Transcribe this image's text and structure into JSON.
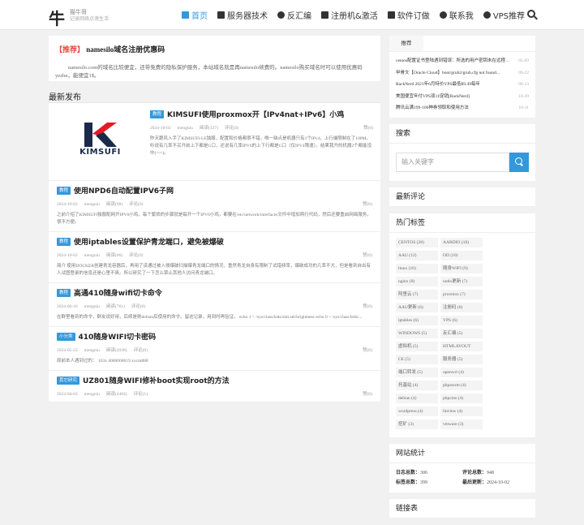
{
  "header": {
    "logo_char": "牛",
    "logo_title": "猫牛哥",
    "logo_sub": "记录网络点滴生活",
    "nav": [
      {
        "label": "首页",
        "icon": "home-icon",
        "active": true
      },
      {
        "label": "服务器技术",
        "icon": "server-icon"
      },
      {
        "label": "反汇编",
        "icon": "flask-icon"
      },
      {
        "label": "注册机&激活",
        "icon": "key-icon"
      },
      {
        "label": "软件订做",
        "icon": "folder-icon"
      },
      {
        "label": "联系我",
        "icon": "user-icon"
      },
      {
        "label": "VPS推荐",
        "icon": "heart-icon"
      }
    ]
  },
  "notice": {
    "tag": "【推荐】",
    "title": "namesilo域名注册优惠码",
    "text": "namesilo.com的域名比较便宜，还带免费的隐私保护服务，本站域名就是再namesilo续费的。namesilo购买域名时可以使用优惠码yezhu，能便宜1$。"
  },
  "latest_title": "最新发布",
  "posts": [
    {
      "cat": "教程",
      "title": "KIMSUFI使用proxmox开【IPv4nat+IPv6】小鸡",
      "date": "2024-10-02",
      "author": "mengniu",
      "reads": "阅读(127)",
      "comments": "评论(0)",
      "likes": "赞(0)",
      "excerpt": "昨天跟风入手了KIMSUFI-LE独服，配置和价格都很不错。唯一缺点是机器只有1个IPv4，上行端限制在了100M。听说有几率不买开前上下都是G口，还说有几率IPV6的上下行都是G口（仅IPV4限速）。结果我开的机器2个都能没中(^~^)。",
      "thumb_text": "KIMSUFI"
    },
    {
      "cat": "教程",
      "title": "使用NPD6自动配置IPV6子网",
      "date": "2024-10-02",
      "author": "mengniu",
      "reads": "阅读(98)",
      "comments": "评论(0)",
      "likes": "赞(0)",
      "excerpt": "之前介绍了KIMSUFI独服配网开IPV6小鸡，每个繁琐的步骤就是每开一个IPV6小鸡，都要在/etc/network/interfaces文件中增加两行代码，然后还要重启网络服务，很不方便。"
    },
    {
      "cat": "教程",
      "title": "使用iptables设置保护青龙端口，避免被爆破",
      "date": "2024-10-02",
      "author": "mengniu",
      "reads": "阅读(66)",
      "comments": "评论(0)",
      "likes": "赞(0)",
      "excerpt": "简介 使用DOCKER创建青龙容器后，再用了该通过被入侵爆破扫描爆青龙端口的情况，重然青龙自身有限制了试错频率，爆破成功的几率不大，但是看到自出有人试图登录的信息还是心里不爽。所以研究了一下怎么禁止其他人访问青龙端口。"
    },
    {
      "cat": "教程",
      "title": "高通410随身wifi切卡命令",
      "date": "2024-06-16",
      "author": "mengniu",
      "reads": "阅读(761)",
      "comments": "评论(0)",
      "likes": "赞(0)",
      "excerpt": "在群里看到的命令，群友说好用，后续是刷debian后使用的命令。留这记录，用到时再验证。 echo 1 > /sys/class/leds/sim:sel/brightness echo 0 > /sys/class/leds/..."
    },
    {
      "cat": "小分类",
      "title": "410随身WIFI切卡密码",
      "date": "2024-05-23",
      "author": "mengniu",
      "reads": "阅读(2038)",
      "comments": "评论(0)",
      "likes": "赞(0)",
      "excerpt": "原前本人遇到过的： 103x 4000000619 xxcm888"
    },
    {
      "cat": "其它研究",
      "title": "UZ801随身WIFI修补boot实现root的方法",
      "date": "2024-04-03",
      "author": "mengniu",
      "reads": "阅读(4484)",
      "comments": "评论(1)",
      "likes": "赞(0)",
      "excerpt": ""
    }
  ],
  "sidebar": {
    "tab_label": "推荐",
    "recent": [
      {
        "title": "centos配置证书登陆遇到错误：所选的用户密钥未在远程主机上注册",
        "date": "05-09"
      },
      {
        "title": "甲骨文【Oracle Cloud】boot/grub2/grub.cfg not found...",
        "date": "09-22"
      },
      {
        "title": "RackNerd 2021年6月特价VPS最低$9.49每年",
        "date": "06-13"
      },
      {
        "title": "美国便宜年付VPS双11促销[RackNerd]",
        "date": "10-29"
      },
      {
        "title": "腾讯云满199-100神券领取和使用方法",
        "date": "10-11"
      }
    ],
    "search_title": "搜索",
    "search_placeholder": "输入关键字",
    "comments_title": "最新评论",
    "tags_title": "热门标签",
    "tags": [
      "CENTOS (28)",
      "AARDIO (18)",
      "AAU (12)",
      "OD (10)",
      "linux (10)",
      "随身WIFI (9)",
      "nginx (8)",
      "uotlo更新 (7)",
      "阿里云 (7)",
      "proxmox (7)",
      "AAU更新 (6)",
      "注册码 (6)",
      "iptables (6)",
      "VPS (6)",
      "WINDOWS (5)",
      "反汇编 (5)",
      "虚拟机 (5)",
      "HTMLAYOUT",
      "CE (5)",
      "服务器 (5)",
      "端口转发 (5)",
      "openwrt (4)",
      "托基站 (4)",
      "phpstorm (4)",
      "debian (4)",
      "phpcms (4)",
      "wordpress (4)",
      "linview (4)",
      "挖矿 (3)",
      "vmware (3)"
    ],
    "stats_title": "网站统计",
    "stats": {
      "log_label": "日志总数：",
      "log_value": "306",
      "comment_label": "评论总数：",
      "comment_value": "948",
      "tag_label": "标签总数：",
      "tag_value": "399",
      "update_label": "最后更新：",
      "update_value": "2024-10-02"
    },
    "links_title": "链接表"
  },
  "colors": {
    "accent": "#3498db",
    "recommend": "#e74c3c"
  }
}
